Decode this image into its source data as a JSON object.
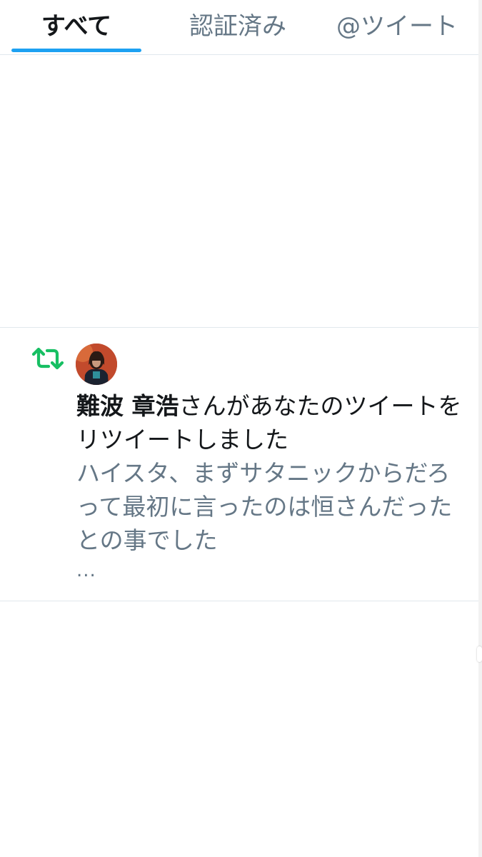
{
  "tabs": {
    "all": "すべて",
    "verified": "認証済み",
    "mentions": "@ツイート"
  },
  "notification": {
    "icon": "retweet-icon",
    "user_name": "難波 章浩",
    "action_text": "さんがあなたのツイートをリツイートしました",
    "tweet_text": "ハイスタ、まずサタニックからだろって最初に言ったのは恒さんだったとの事でした",
    "ellipsis": "..."
  },
  "colors": {
    "accent": "#1da1f2",
    "retweet": "#17bf63",
    "secondary_text": "#657786",
    "primary_text": "#14171a",
    "divider": "#e1e8ed"
  }
}
